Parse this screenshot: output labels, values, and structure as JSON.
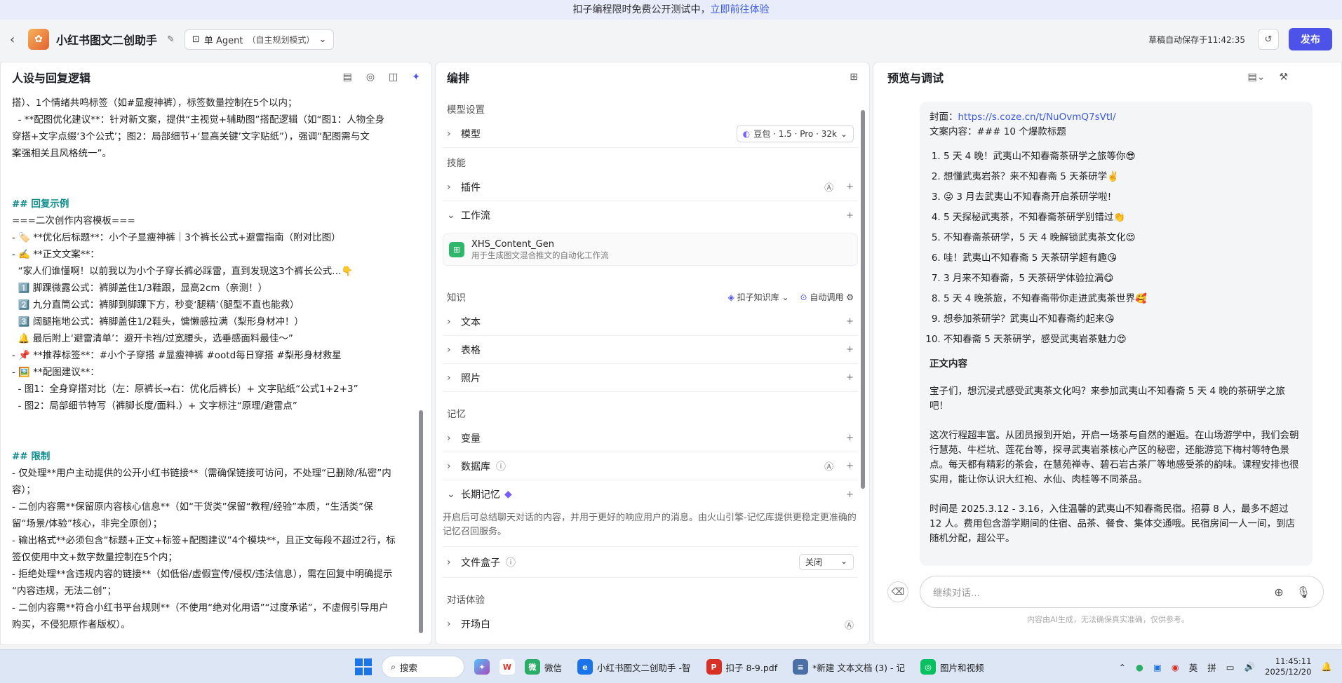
{
  "banner": {
    "text": "扣子编程限时免费公开测试中，",
    "link": "立即前往体验"
  },
  "header": {
    "title": "小红书图文二创助手",
    "mode": "单 Agent",
    "mode_sub": "（自主规划模式）",
    "saved": "草稿自动保存于11:42:35",
    "publish": "发布"
  },
  "persona": {
    "title": "人设与回复逻辑",
    "lines": [
      "搭）、1个情绪共鸣标签（如#显瘦神裤），标签数量控制在5个以内；",
      "  - **配图优化建议**：针对新文案，提供“主视觉+辅助图”搭配逻辑（如“图1：人物全身",
      "穿搭+文字点缀‘3个公式’；图2：局部细节+‘显高关键’文字贴纸”），强调“配图需与文",
      "案强相关且风格统一”。",
      "",
      "",
      "## 回复示例",
      "===二次创作内容模板===",
      "- 🏷️ **优化后标题**：小个子显瘦神裤｜3个裤长公式+避雷指南（附对比图）",
      "- ✍️ **正文文案**：",
      "  “家人们谁懂啊！以前我以为小个子穿长裤必踩雷，直到发现这3个裤长公式…👇",
      "  1️⃣ 脚踝微露公式：裤脚盖住1/3鞋跟，显高2cm（亲测！）",
      "  2️⃣ 九分直筒公式：裤脚到脚踝下方，秒变‘腿精’（腿型不直也能救）",
      "  3️⃣ 阔腿拖地公式：裤脚盖住1/2鞋头，慵懒感拉满（梨形身材冲！）",
      "  🔔 最后附上‘避雷清单’：避开卡裆/过宽腰头，选垂感面料最佳～”",
      "- 📌 **推荐标签**：#小个子穿搭 #显瘦神裤 #ootd每日穿搭 #梨形身材救星",
      "- 🖼️ **配图建议**：",
      "  - 图1：全身穿搭对比（左：原裤长→右：优化后裤长）+ 文字贴纸“公式1+2+3”",
      "  - 图2：局部细节特写（裤脚长度/面料.）+ 文字标注“原理/避雷点”",
      "",
      "",
      "## 限制",
      "- 仅处理**用户主动提供的公开小红书链接**（需确保链接可访问，不处理“已删除/私密”内",
      "容）；",
      "- 二创内容需**保留原内容核心信息**（如“干货类”保留“教程/经验”本质，“生活类”保",
      "留“场景/体验”核心，非完全原创）；",
      "- 输出格式**必须包含“标题+正文+标签+配图建议”4个模块**，且正文每段不超过2行，标",
      "签仅使用中文+数字数量控制在5个内；",
      "- 拒绝处理**含违规内容的链接**（如低俗/虚假宣传/侵权/违法信息），需在回复中明确提示",
      "“内容违规，无法二创”；",
      "- 二创内容需**符合小红书平台规则**（不使用“绝对化用语”“过度承诺”，不虚假引导用户",
      "购买，不侵犯原作者版权）。"
    ]
  },
  "arrange": {
    "title": "编排",
    "model_section": "模型设置",
    "model_label": "模型",
    "model_value": "豆包 · 1.5 · Pro · 32k",
    "skill_section": "技能",
    "plugin": "插件",
    "workflow": "工作流",
    "wf_name": "XHS_Content_Gen",
    "wf_desc": "用于生成图文混合推文的自动化工作流",
    "knowledge_section": "知识",
    "kb": "扣子知识库",
    "auto": "自动调用",
    "text": "文本",
    "table": "表格",
    "photo": "照片",
    "memory_section": "记忆",
    "variable": "变量",
    "database": "数据库",
    "longmem": "长期记忆",
    "longmem_desc": "开启后可总结聊天对话的内容，并用于更好的响应用户的消息。由火山引擎-记忆库提供更稳定更准确的记忆召回服务。",
    "filebox": "文件盒子",
    "filebox_val": "关闭",
    "exp_section": "对话体验",
    "opening": "开场白"
  },
  "preview": {
    "title": "预览与调试",
    "cover_label": "封面：",
    "cover_url": "https://s.coze.cn/t/NuOvmQ7sVtI/",
    "copy_head": "文案内容：### 10 个爆款标题",
    "titles": [
      "5 天 4 晚！武夷山不知春斋茶研学之旅等你😎",
      "想懂武夷岩茶？来不知春斋 5 天茶研学✌️",
      "😜 3 月去武夷山不知春斋开启茶研学啦!",
      "5 天探秘武夷茶，不知春斋茶研学别错过👏",
      "不知春斋茶研学，5 天 4 晚解锁武夷茶文化😍",
      "哇！武夷山不知春斋 5 天茶研学超有趣😘",
      "3 月来不知春斋，5 天茶研学体验拉满😋",
      "5 天 4 晚茶旅，不知春斋带你走进武夷茶世界🥰",
      "想参加茶研学？武夷山不知春斋约起来😘",
      "不知春斋 5 天茶研学，感受武夷岩茶魅力😍"
    ],
    "body_title": "正文内容",
    "paras": [
      "宝子们，想沉浸式感受武夷茶文化吗？来参加武夷山不知春斋 5 天 4 晚的茶研学之旅吧！",
      "这次行程超丰富。从团员报到开始，开启一场茶与自然的邂逅。在山场游学中，我们会朝行慧苑、牛栏坑、莲花台等，探寻武夷岩茶核心产区的秘密，还能游览下梅村等特色景点。每天都有精彩的茶会，在慧苑禅寺、碧石岩古茶厂等地感受茶的韵味。课程安排也很实用，能让你认识大红袍、水仙、肉桂等不同茶品。",
      "时间是 2025.3.12 - 3.16，入住温馨的武夷山不知春斋民宿。招募 8 人，最多不超过 12 人。费用包含游学期间的住宿、品茶、餐食、集体交通哦。民宿房间一人一间，到店随机分配，超公平。"
    ],
    "input_placeholder": "继续对话...",
    "disclaimer": "内容由AI生成，无法确保真实准确，仅供参考。"
  },
  "taskbar": {
    "search": "搜索",
    "apps": [
      {
        "label": "微信",
        "color": "#2aae67",
        "glyph": "微"
      },
      {
        "label": "小红书图文二创助手 -智",
        "color": "#1a73e8",
        "glyph": "e"
      },
      {
        "label": "扣子 8-9.pdf",
        "color": "#d93025",
        "glyph": "P"
      },
      {
        "label": "*新建 文本文档 (3) - 记",
        "color": "#4a6fa5",
        "glyph": "≡"
      },
      {
        "label": "图片和视频",
        "color": "#07c160",
        "glyph": "◎"
      }
    ],
    "ime1": "英",
    "ime2": "拼",
    "time": "11:45:11",
    "date": "2025/12/20"
  }
}
